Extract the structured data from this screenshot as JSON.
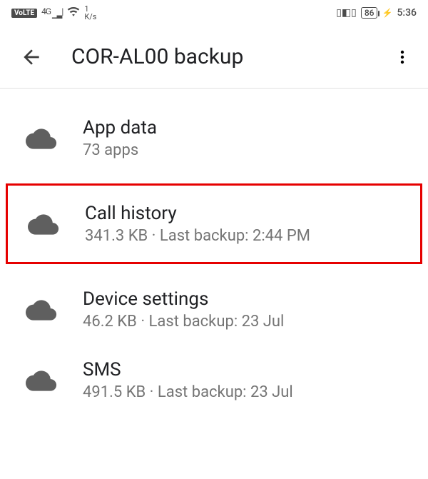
{
  "status": {
    "volte": "VoLTE",
    "network": "4G",
    "speed_num": "1",
    "speed_unit": "K/s",
    "battery": "86",
    "charging": "⚡",
    "time": "5:36"
  },
  "header": {
    "title": "COR-AL00 backup"
  },
  "items": [
    {
      "title": "App data",
      "subtitle": "73 apps",
      "highlighted": false
    },
    {
      "title": "Call history",
      "subtitle": "341.3 KB · Last backup: 2:44 PM",
      "highlighted": true
    },
    {
      "title": "Device settings",
      "subtitle": "46.2 KB · Last backup: 23 Jul",
      "highlighted": false
    },
    {
      "title": "SMS",
      "subtitle": "491.5 KB · Last backup: 23 Jul",
      "highlighted": false
    }
  ]
}
